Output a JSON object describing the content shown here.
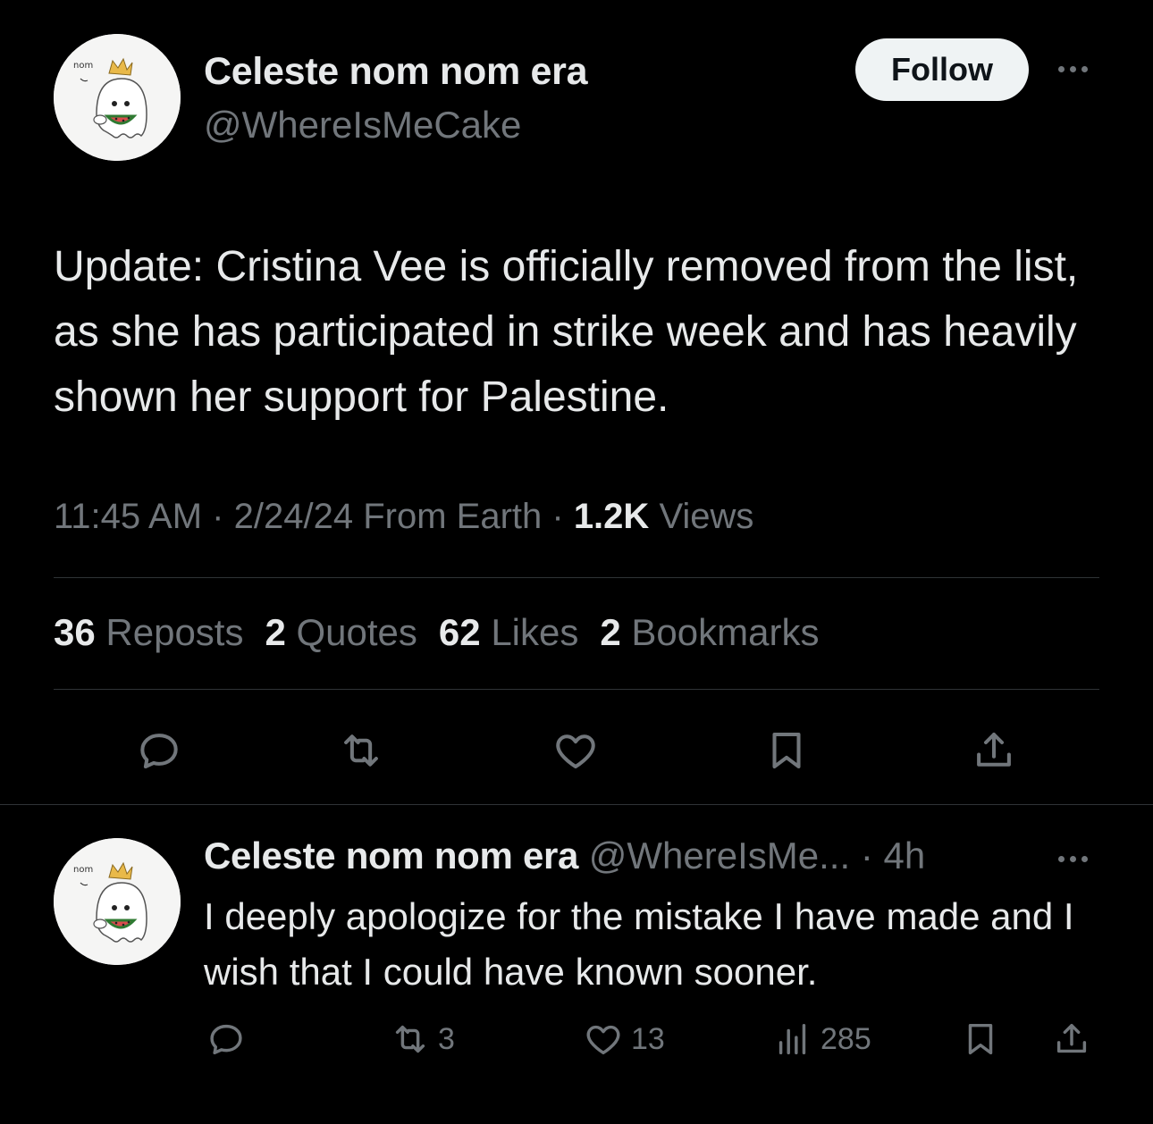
{
  "tweet": {
    "author": {
      "display_name": "Celeste nom nom era",
      "handle": "@WhereIsMeCake",
      "avatar_text": "nom"
    },
    "follow_label": "Follow",
    "text": "Update: Cristina Vee is officially removed from the list, as she has participated in strike week and has heavily shown her support for Palestine.",
    "time": "11:45 AM",
    "date": "2/24/24",
    "source": "From Earth",
    "views_count": "1.2K",
    "views_label": "Views",
    "stats": {
      "reposts": {
        "count": "36",
        "label": "Reposts"
      },
      "quotes": {
        "count": "2",
        "label": "Quotes"
      },
      "likes": {
        "count": "62",
        "label": "Likes"
      },
      "bookmarks": {
        "count": "2",
        "label": "Bookmarks"
      }
    },
    "actions": [
      "reply-icon",
      "repost-icon",
      "like-icon",
      "bookmark-icon",
      "share-icon"
    ]
  },
  "reply": {
    "author": {
      "display_name": "Celeste nom nom era",
      "handle": "@WhereIsMe...",
      "time": "4h",
      "avatar_text": "nom"
    },
    "text": "I deeply apologize for the mistake I have made and I wish that I could have known sooner.",
    "counts": {
      "reposts": "3",
      "likes": "13",
      "views": "285"
    }
  },
  "colors": {
    "background": "#000000",
    "text_primary": "#e7e9ea",
    "text_secondary": "#71767b",
    "divider": "#2f3336",
    "follow_bg": "#eff3f4"
  }
}
